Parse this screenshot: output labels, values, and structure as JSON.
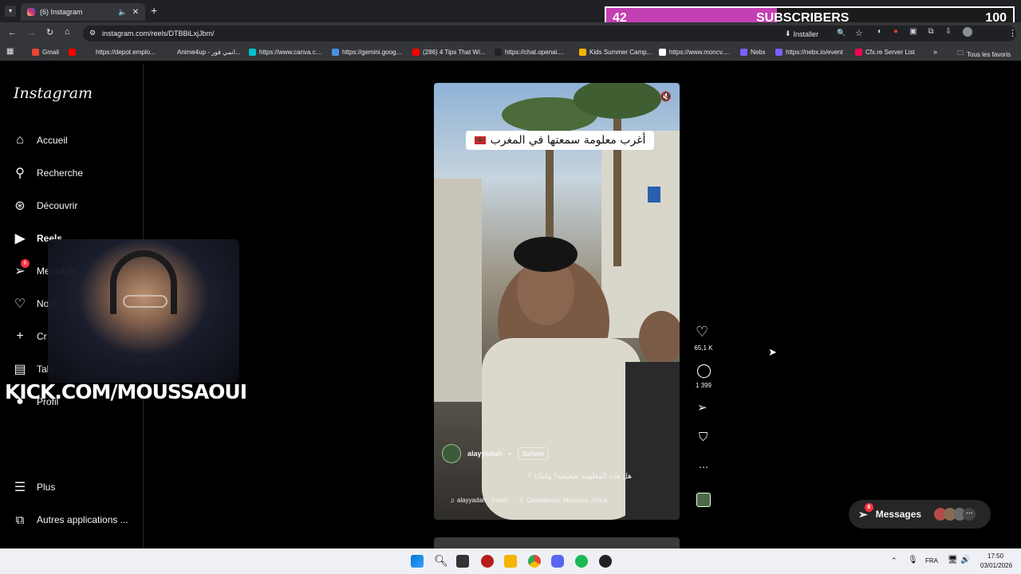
{
  "browser": {
    "tab_title": "(6) Instagram",
    "url": "instagram.com/reels/DTBBiLxjJbm/",
    "install_label": "Installer",
    "bookmarks": [
      {
        "label": "Gmail",
        "color": "#ea4335"
      },
      {
        "label": "",
        "color": "#ff0000"
      },
      {
        "label": "https://depot.emplo...",
        "color": ""
      },
      {
        "label": "Anime4up - انمي فور...",
        "color": ""
      },
      {
        "label": "https://www.canva.c...",
        "color": "#00c4cc"
      },
      {
        "label": "https://gemini.goog...",
        "color": "#4a90e2"
      },
      {
        "label": "(286) 4 Tips That Wi...",
        "color": "#ff0000"
      },
      {
        "label": "https://chat.openai....",
        "color": "#222222"
      },
      {
        "label": "Kids Summer Camp...",
        "color": "#f4b400"
      },
      {
        "label": "https://www.moncv....",
        "color": "#ffffff"
      },
      {
        "label": "Nebx",
        "color": "#7b61ff"
      },
      {
        "label": "https://nebx.io/event",
        "color": "#7b61ff"
      },
      {
        "label": "Cfx.re Server List",
        "color": "#f40552"
      }
    ],
    "all_bookmarks_label": "Tous les favoris"
  },
  "subscribers": {
    "current": "42",
    "label": "SUBSCRIBERS",
    "goal": "100",
    "progress": 0.42,
    "fill_color": "#c43fb3"
  },
  "instagram": {
    "logo": "Instagram",
    "nav": [
      {
        "label": "Accueil",
        "icon": "home-icon"
      },
      {
        "label": "Recherche",
        "icon": "search-icon"
      },
      {
        "label": "Découvrir",
        "icon": "compass-icon"
      },
      {
        "label": "Reels",
        "icon": "reels-icon"
      },
      {
        "label": "Message",
        "icon": "messenger-icon",
        "badge": "6"
      },
      {
        "label": "Notifi",
        "icon": "heart-icon"
      },
      {
        "label": "Cr",
        "icon": "plus-icon"
      },
      {
        "label": "Tabl",
        "icon": "dashboard-icon"
      },
      {
        "label": "Profil",
        "icon": "avatar"
      }
    ],
    "more_label": "Plus",
    "other_apps_label": "Autres applications ..."
  },
  "reel": {
    "caption_overlay": "أغرب معلومة سمعتها في المغرب",
    "username": "alayyadah",
    "separator": "•",
    "follow_label": "Suivre",
    "description": "هل هذه المعلومة صحيحة؟ ولماذا ؟",
    "audio": "alayyadah · Audio",
    "location": "Casablanca, Morocco, Africa",
    "likes": "65,1 K",
    "comments": "1 399"
  },
  "overlay": {
    "kick_text": "KICK.COM/MOUSSAOUI"
  },
  "messages_pill": {
    "label": "Messages",
    "badge": "6"
  },
  "taskbar": {
    "language": "FRA",
    "time": "17:50",
    "date": "03/01/2026"
  }
}
